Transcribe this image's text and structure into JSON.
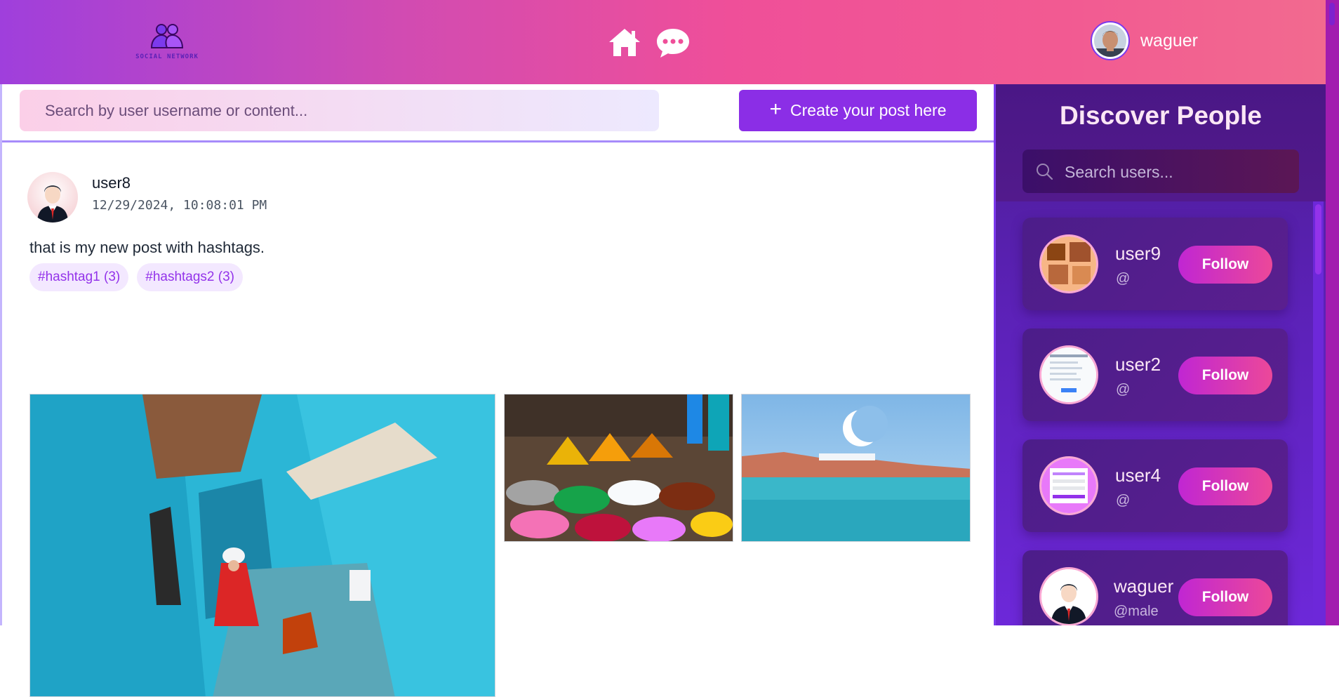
{
  "header": {
    "logo_text": "SOCIAL NETWORK",
    "icons": [
      "home-icon",
      "chat-icon"
    ],
    "user": {
      "name": "waguer"
    }
  },
  "feed": {
    "search_placeholder": "Search by user username or content...",
    "create_button": {
      "icon": "plus-icon",
      "label": "Create your post here"
    },
    "post": {
      "username": "user8",
      "timestamp": "12/29/2024, 10:08:01 PM",
      "content": "that is my new post with hashtags.",
      "hashtags": [
        "#hashtag1 (3)",
        "#hashtags2 (3)"
      ],
      "images": [
        "blue-alley-photo",
        "spice-market-photo",
        "coastal-town-photo"
      ]
    }
  },
  "sidebar": {
    "title": "Discover People",
    "search_placeholder": "Search users...",
    "users": [
      {
        "name": "user9",
        "handle": "@",
        "button": "Follow"
      },
      {
        "name": "user2",
        "handle": "@",
        "button": "Follow"
      },
      {
        "name": "user4",
        "handle": "@",
        "button": "Follow"
      },
      {
        "name": "waguer",
        "handle": "@male",
        "button": "Follow"
      }
    ]
  },
  "colors": {
    "header_gradient_start": "#9f3fdc",
    "header_gradient_end": "#f26a8f",
    "accent_purple": "#8b2ee6",
    "sidebar_bg": "#5b21b6",
    "follow_gradient": "#c026d3"
  }
}
